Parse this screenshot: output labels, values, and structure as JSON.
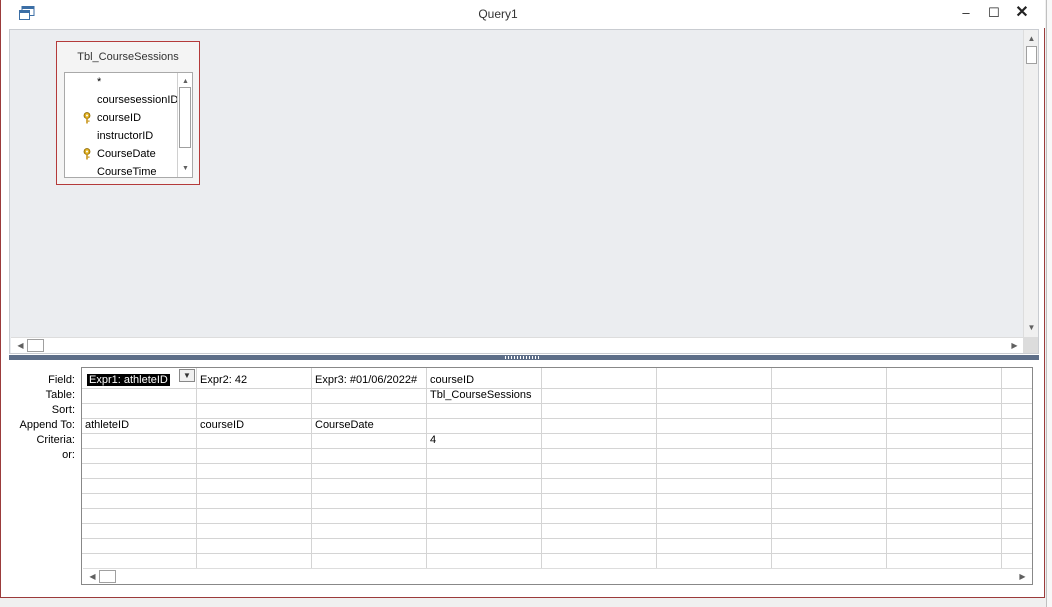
{
  "window": {
    "title": "Query1",
    "icon": "query-window-icon",
    "controls": {
      "minimize": "–",
      "maximize": "☐",
      "close": "✕"
    }
  },
  "table_box": {
    "title": "Tbl_CourseSessions",
    "fields": [
      {
        "label": "*",
        "primary_key": false
      },
      {
        "label": "coursesessionID",
        "primary_key": false
      },
      {
        "label": "courseID",
        "primary_key": true
      },
      {
        "label": "instructorID",
        "primary_key": false
      },
      {
        "label": "CourseDate",
        "primary_key": true
      },
      {
        "label": "CourseTime",
        "primary_key": false
      }
    ]
  },
  "grid": {
    "row_labels": [
      "Field:",
      "Table:",
      "Sort:",
      "Append To:",
      "Criteria:",
      "or:"
    ],
    "columns": [
      {
        "field": "Expr1: athleteID",
        "table": "",
        "sort": "",
        "append_to": "athleteID",
        "criteria": "",
        "or": ""
      },
      {
        "field": "Expr2: 42",
        "table": "",
        "sort": "",
        "append_to": "courseID",
        "criteria": "",
        "or": ""
      },
      {
        "field": "Expr3: #01/06/2022#",
        "table": "",
        "sort": "",
        "append_to": "CourseDate",
        "criteria": "",
        "or": ""
      },
      {
        "field": "courseID",
        "table": "Tbl_CourseSessions",
        "sort": "",
        "append_to": "",
        "criteria": "4",
        "or": ""
      }
    ]
  },
  "colors": {
    "table_border": "#b43a3a",
    "splitter": "#5d6e88",
    "design_background": "#ebedf0",
    "selection": "#000000"
  }
}
